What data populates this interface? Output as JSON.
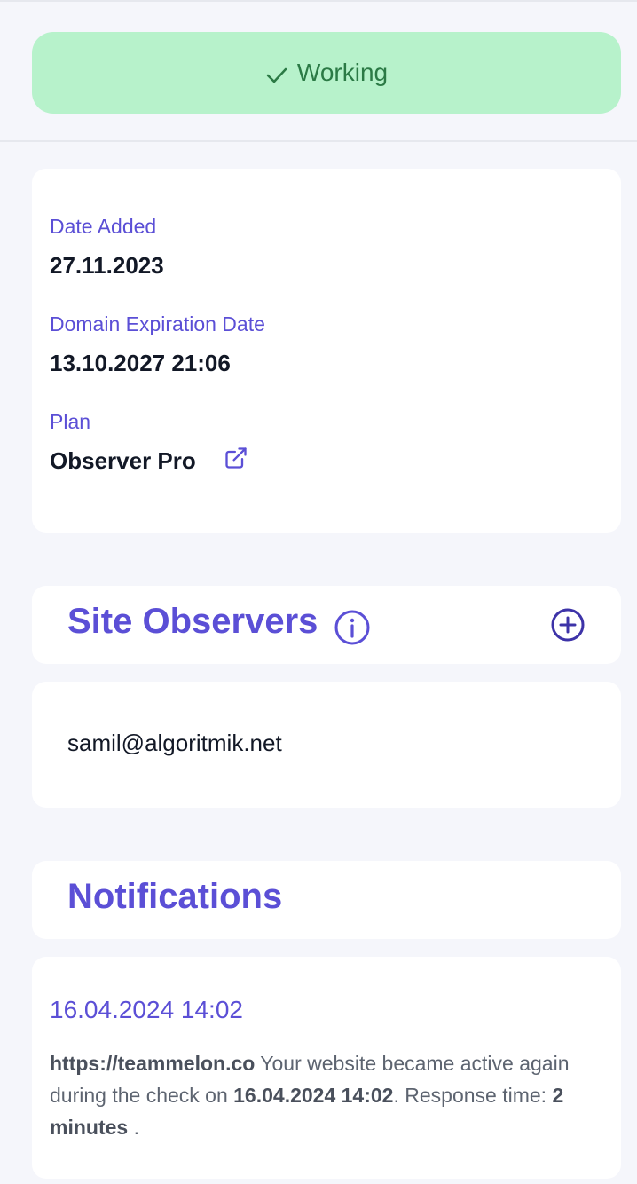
{
  "status": {
    "label": "Working",
    "icon": "check-icon",
    "bg_color": "#b7f2cb",
    "text_color": "#2b7a45"
  },
  "details": {
    "date_added_label": "Date Added",
    "date_added_value": "27.11.2023",
    "expiration_label": "Domain Expiration Date",
    "expiration_value": "13.10.2027 21:06",
    "plan_label": "Plan",
    "plan_value": "Observer Pro",
    "plan_icon": "external-link-icon"
  },
  "observers": {
    "title": "Site Observers",
    "info_icon": "info-icon",
    "add_icon": "add-circle-icon",
    "items": [
      "samil@algoritmik.net"
    ]
  },
  "notifications": {
    "title": "Notifications",
    "items": [
      {
        "date": "16.04.2024 14:02",
        "url": "https://teammelon.co",
        "text_1": " Your website became active again during the check on ",
        "check_time": "16.04.2024 14:02",
        "text_2": ". Response time: ",
        "response_time": "2 minutes",
        "text_3": " ."
      }
    ]
  },
  "colors": {
    "accent": "#5b4fd6",
    "page_bg": "#f5f6fb",
    "card_bg": "#ffffff"
  }
}
